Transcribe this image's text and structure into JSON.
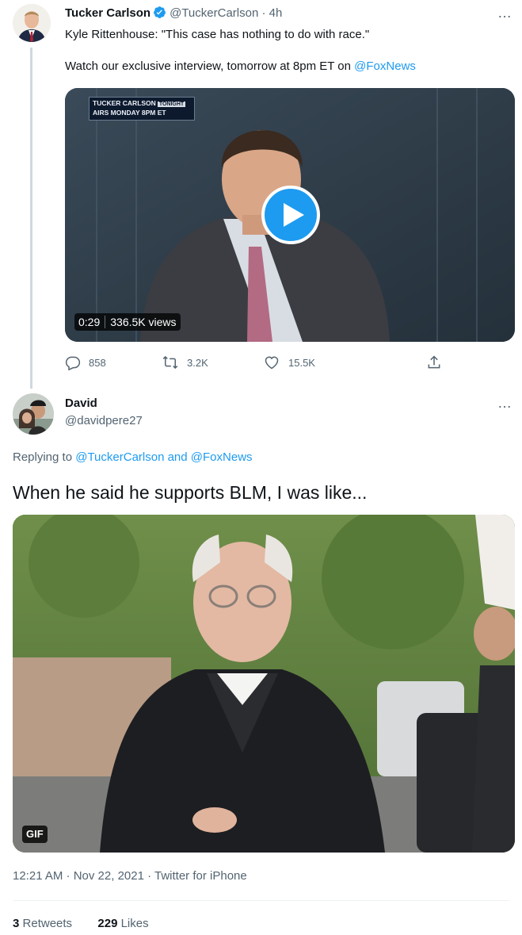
{
  "parent_tweet": {
    "author_name": "Tucker Carlson",
    "author_handle": "@TuckerCarlson",
    "separator": "·",
    "time": "4h",
    "text_line1": "Kyle Rittenhouse: \"This case has nothing to do with race.\"",
    "text_line2_prefix": "Watch our exclusive interview, tomorrow at 8pm ET on ",
    "text_line2_mention": "@FoxNews",
    "video": {
      "badge_line1": "TUCKER CARLSON",
      "badge_tonight": "TONIGHT",
      "badge_line2": "AIRS MONDAY 8PM ET",
      "duration": "0:29",
      "views": "336.5K views"
    },
    "actions": {
      "replies": "858",
      "retweets": "3.2K",
      "likes": "15.5K"
    },
    "more_icon": "…"
  },
  "reply_tweet": {
    "author_name": "David",
    "author_handle": "@davidpere27",
    "more_icon": "…",
    "replying_prefix": "Replying to ",
    "replying_to_1": "@TuckerCarlson",
    "replying_and": " and ",
    "replying_to_2": "@FoxNews",
    "text": "When he said he supports BLM, I was like...",
    "gif_badge": "GIF",
    "meta": "12:21 AM · Nov 22, 2021 · Twitter for iPhone",
    "retweet_count": "3",
    "retweet_label": "Retweets",
    "like_count": "229",
    "like_label": "Likes"
  },
  "colors": {
    "accent": "#1d9bf0",
    "text_primary": "#0f1419",
    "text_secondary": "#536471"
  },
  "icons": [
    "verified-badge-icon",
    "more-icon",
    "play-icon",
    "reply-icon",
    "retweet-icon",
    "like-icon",
    "share-icon"
  ]
}
